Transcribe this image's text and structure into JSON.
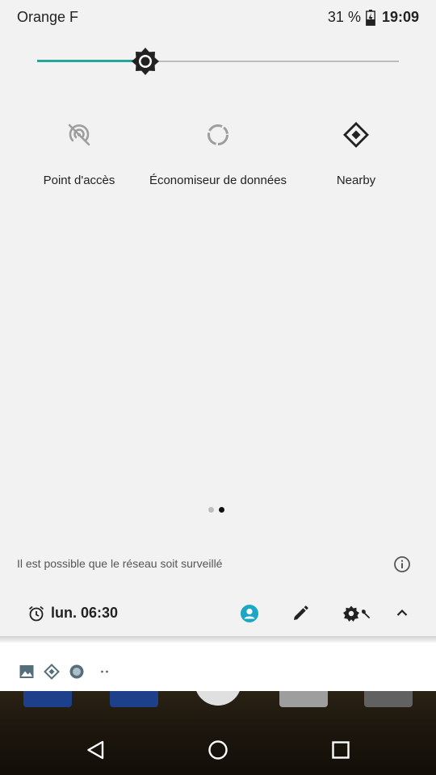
{
  "status_bar": {
    "carrier": "Orange F",
    "battery_percent": "31 %",
    "time": "19:09"
  },
  "brightness": {
    "level": 0.3,
    "icon": "brightness-icon",
    "accent_color": "#26a69a"
  },
  "tiles": [
    {
      "label": "Point d'accès",
      "icon": "hotspot-off-icon"
    },
    {
      "label": "Économiseur de données",
      "icon": "data-saver-icon"
    },
    {
      "label": "Nearby",
      "icon": "nearby-icon"
    }
  ],
  "pager": {
    "pages": 2,
    "current": 2
  },
  "footer": {
    "message": "Il est possible que le réseau soit surveillé",
    "info_icon": "info-icon"
  },
  "bottom_bar": {
    "alarm_time": "lun. 06:30",
    "user_color": "#1ea7c4"
  },
  "notification_icons": [
    "image-icon",
    "nearby-icon",
    "circle-icon",
    "more-dots-icon"
  ],
  "nav_bar": [
    "back-icon",
    "home-icon",
    "recents-icon"
  ]
}
